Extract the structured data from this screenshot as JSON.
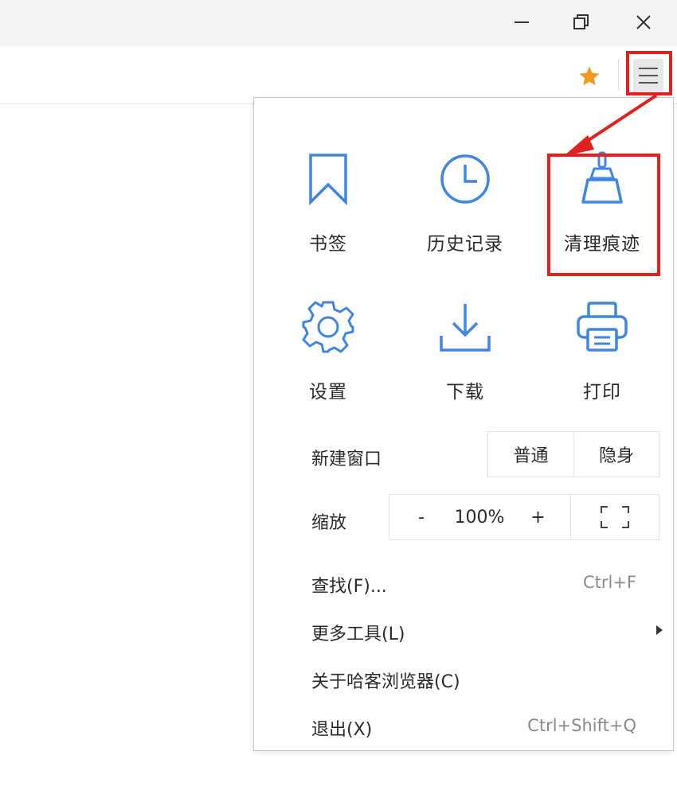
{
  "window": {
    "minimize_icon": "minimize-icon",
    "restore_icon": "restore-icon",
    "close_icon": "close-icon"
  },
  "toolbar": {
    "star_icon": "star-icon",
    "star_color": "#f29a1e",
    "menu_icon": "hamburger-menu-icon"
  },
  "menu": {
    "accent_color": "#3f86e0",
    "highlight_color": "#e3201c",
    "tiles": [
      {
        "label": "书签",
        "icon": "bookmark-icon"
      },
      {
        "label": "历史记录",
        "icon": "clock-icon"
      },
      {
        "label": "清理痕迹",
        "icon": "broom-icon"
      },
      {
        "label": "设置",
        "icon": "gear-icon"
      },
      {
        "label": "下载",
        "icon": "download-icon"
      },
      {
        "label": "打印",
        "icon": "printer-icon"
      }
    ],
    "new_window": {
      "label": "新建窗口",
      "normal": "普通",
      "incognito": "隐身"
    },
    "zoom": {
      "label": "缩放",
      "minus": "-",
      "value": "100%",
      "plus": "+",
      "fullscreen_icon": "fullscreen-icon"
    },
    "items": [
      {
        "label": "查找(F)...",
        "shortcut": "Ctrl+F"
      },
      {
        "label": "更多工具(L)",
        "shortcut": ""
      },
      {
        "label": "关于哈客浏览器(C)",
        "shortcut": ""
      },
      {
        "label": "退出(X)",
        "shortcut": "Ctrl+Shift+Q"
      }
    ]
  }
}
